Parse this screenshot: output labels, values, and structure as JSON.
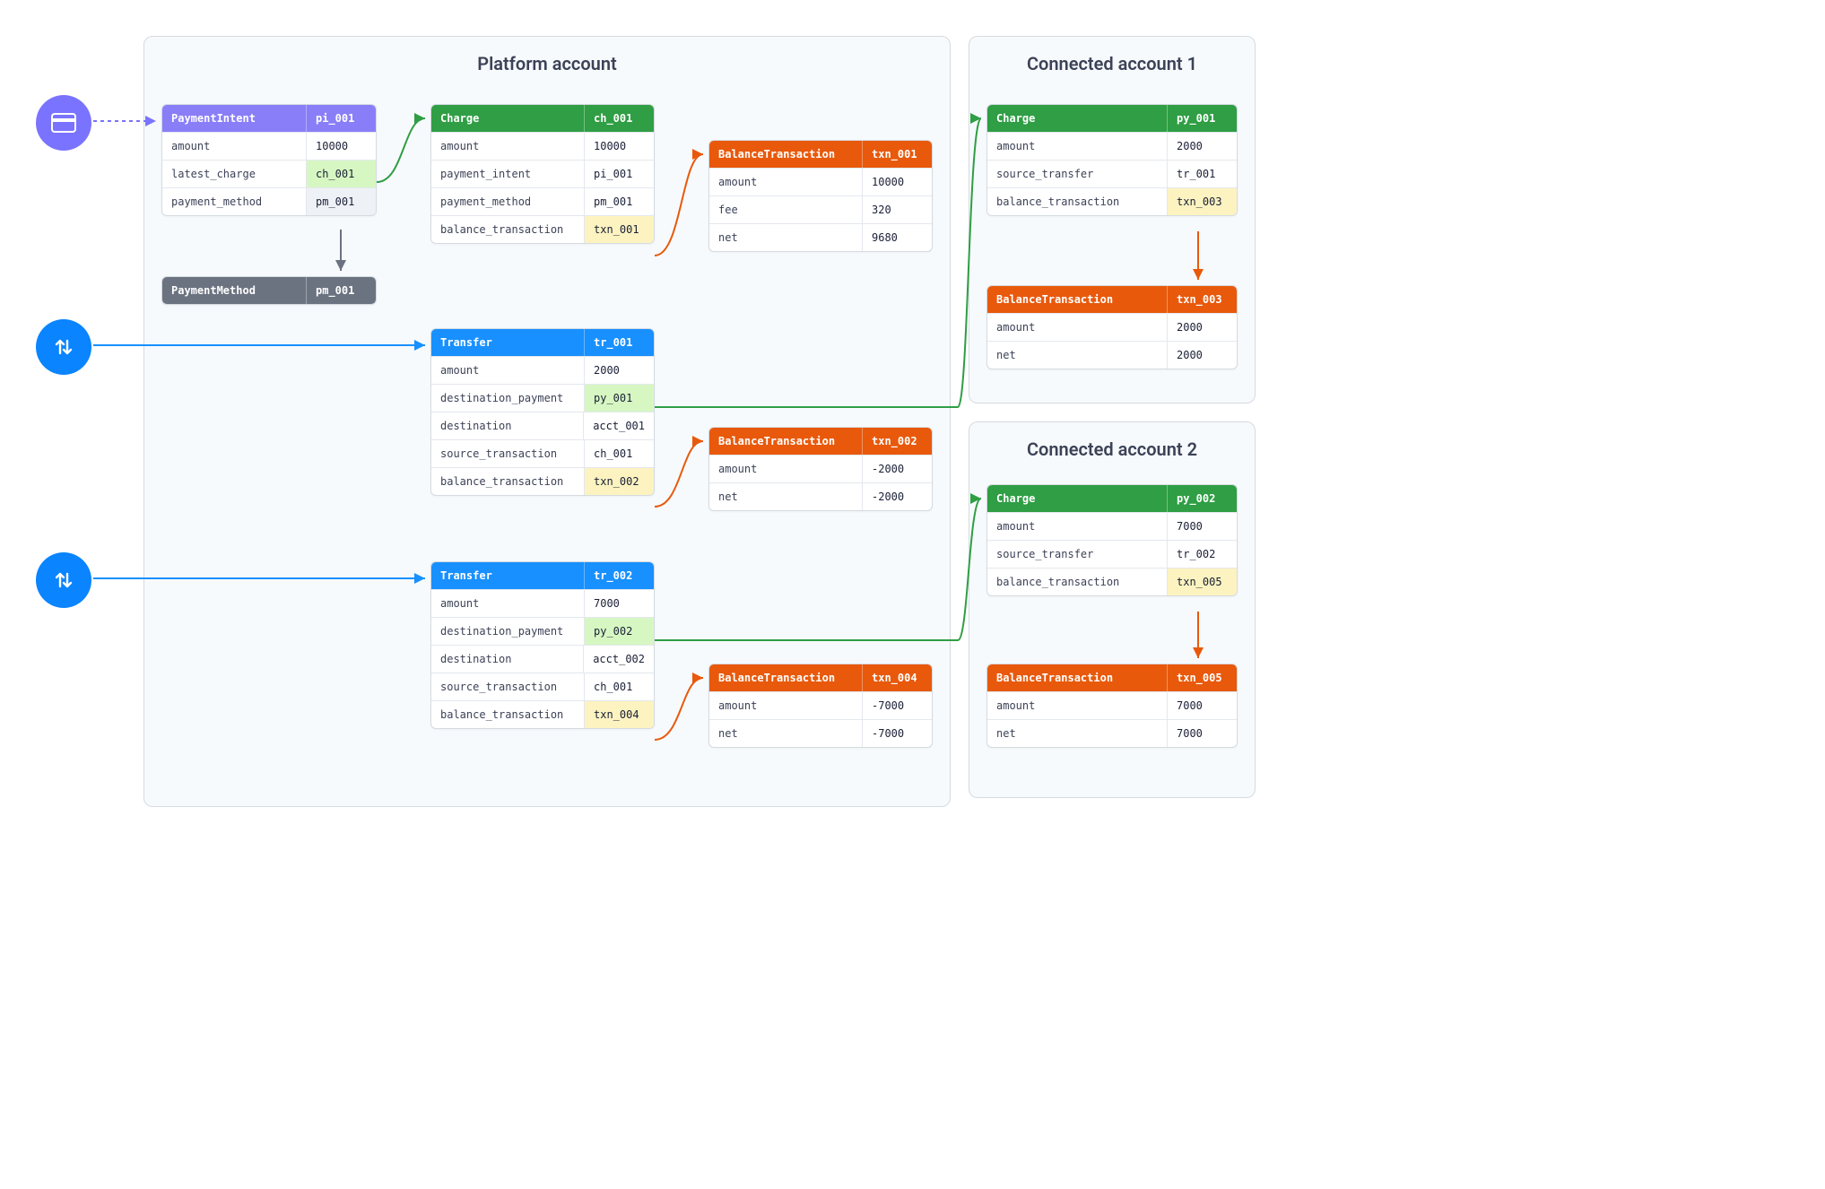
{
  "groups": {
    "platform": "Platform account",
    "connected1": "Connected account 1",
    "connected2": "Connected account 2"
  },
  "payment_intent": {
    "title": "PaymentIntent",
    "id": "pi_001",
    "rows": [
      {
        "k": "amount",
        "v": "10000"
      },
      {
        "k": "latest_charge",
        "v": "ch_001"
      },
      {
        "k": "payment_method",
        "v": "pm_001"
      }
    ]
  },
  "payment_method": {
    "title": "PaymentMethod",
    "id": "pm_001"
  },
  "charge": {
    "title": "Charge",
    "id": "ch_001",
    "rows": [
      {
        "k": "amount",
        "v": "10000"
      },
      {
        "k": "payment_intent",
        "v": "pi_001"
      },
      {
        "k": "payment_method",
        "v": "pm_001"
      },
      {
        "k": "balance_transaction",
        "v": "txn_001"
      }
    ]
  },
  "txn_001": {
    "title": "BalanceTransaction",
    "id": "txn_001",
    "rows": [
      {
        "k": "amount",
        "v": "10000"
      },
      {
        "k": "fee",
        "v": "320"
      },
      {
        "k": "net",
        "v": "9680"
      }
    ]
  },
  "transfer1": {
    "title": "Transfer",
    "id": "tr_001",
    "rows": [
      {
        "k": "amount",
        "v": "2000"
      },
      {
        "k": "destination_payment",
        "v": "py_001"
      },
      {
        "k": "destination",
        "v": "acct_001"
      },
      {
        "k": "source_transaction",
        "v": "ch_001"
      },
      {
        "k": "balance_transaction",
        "v": "txn_002"
      }
    ]
  },
  "txn_002": {
    "title": "BalanceTransaction",
    "id": "txn_002",
    "rows": [
      {
        "k": "amount",
        "v": "-2000"
      },
      {
        "k": "net",
        "v": "-2000"
      }
    ]
  },
  "transfer2": {
    "title": "Transfer",
    "id": "tr_002",
    "rows": [
      {
        "k": "amount",
        "v": "7000"
      },
      {
        "k": "destination_payment",
        "v": "py_002"
      },
      {
        "k": "destination",
        "v": "acct_002"
      },
      {
        "k": "source_transaction",
        "v": "ch_001"
      },
      {
        "k": "balance_transaction",
        "v": "txn_004"
      }
    ]
  },
  "txn_004": {
    "title": "BalanceTransaction",
    "id": "txn_004",
    "rows": [
      {
        "k": "amount",
        "v": "-7000"
      },
      {
        "k": "net",
        "v": "-7000"
      }
    ]
  },
  "c1_charge": {
    "title": "Charge",
    "id": "py_001",
    "rows": [
      {
        "k": "amount",
        "v": "2000"
      },
      {
        "k": "source_transfer",
        "v": "tr_001"
      },
      {
        "k": "balance_transaction",
        "v": "txn_003"
      }
    ]
  },
  "txn_003": {
    "title": "BalanceTransaction",
    "id": "txn_003",
    "rows": [
      {
        "k": "amount",
        "v": "2000"
      },
      {
        "k": "net",
        "v": "2000"
      }
    ]
  },
  "c2_charge": {
    "title": "Charge",
    "id": "py_002",
    "rows": [
      {
        "k": "amount",
        "v": "7000"
      },
      {
        "k": "source_transfer",
        "v": "tr_002"
      },
      {
        "k": "balance_transaction",
        "v": "txn_005"
      }
    ]
  },
  "txn_005": {
    "title": "BalanceTransaction",
    "id": "txn_005",
    "rows": [
      {
        "k": "amount",
        "v": "7000"
      },
      {
        "k": "net",
        "v": "7000"
      }
    ]
  }
}
